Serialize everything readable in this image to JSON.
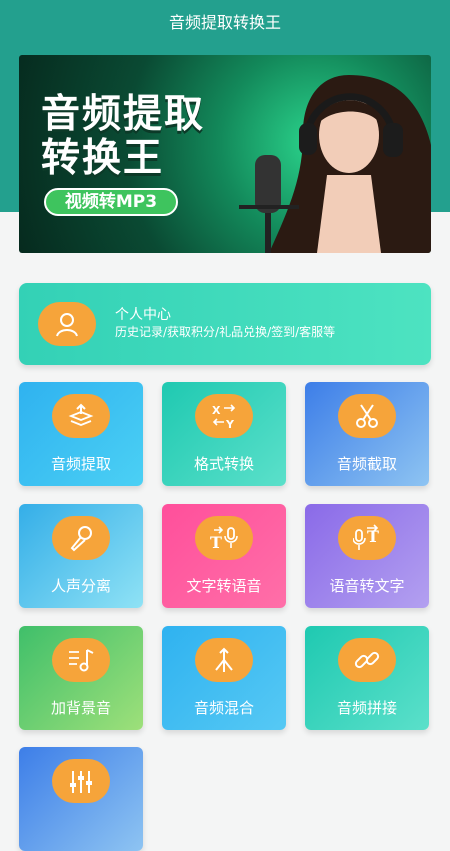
{
  "app": {
    "title": "音频提取转换王"
  },
  "banner": {
    "title_line1": "音频提取",
    "title_line2": "转换王",
    "pill": "视频转MP3"
  },
  "profile": {
    "title": "个人中心",
    "subtitle": "历史记录/获取积分/礼品兑换/签到/客服等"
  },
  "tiles": [
    {
      "label": "音频提取",
      "icon": "audio-extract-icon"
    },
    {
      "label": "格式转换",
      "icon": "format-convert-icon"
    },
    {
      "label": "音频截取",
      "icon": "scissors-icon"
    },
    {
      "label": "人声分离",
      "icon": "microphone-icon"
    },
    {
      "label": "文字转语音",
      "icon": "text-to-speech-icon"
    },
    {
      "label": "语音转文字",
      "icon": "speech-to-text-icon"
    },
    {
      "label": "加背景音",
      "icon": "music-note-icon"
    },
    {
      "label": "音频混合",
      "icon": "merge-arrows-icon"
    },
    {
      "label": "音频拼接",
      "icon": "link-icon"
    },
    {
      "label": "",
      "icon": "equalizer-icon"
    }
  ],
  "colors": {
    "header": "#23a08e",
    "icon_circle": "#f6a43a",
    "profile_card": "#3fd9bb"
  }
}
